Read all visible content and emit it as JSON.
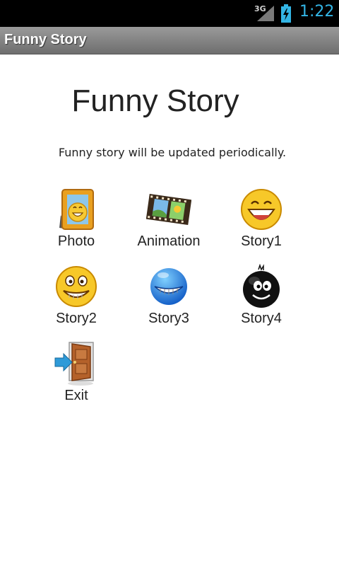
{
  "status_bar": {
    "network": "3G",
    "time": "1:22"
  },
  "title_bar": {
    "title": "Funny Story"
  },
  "main": {
    "heading": "Funny Story",
    "subtitle": "Funny story will be updated periodically.",
    "items": [
      {
        "label": "Photo",
        "icon": "photo-frame-icon"
      },
      {
        "label": "Animation",
        "icon": "film-strip-icon"
      },
      {
        "label": "Story1",
        "icon": "laughing-face-icon"
      },
      {
        "label": "Story2",
        "icon": "grinning-face-icon"
      },
      {
        "label": "Story3",
        "icon": "blue-grin-face-icon"
      },
      {
        "label": "Story4",
        "icon": "black-smiley-icon"
      },
      {
        "label": "Exit",
        "icon": "exit-door-icon"
      }
    ]
  },
  "colors": {
    "accent": "#33b5e5",
    "title_bar": "#8a8a8a"
  }
}
